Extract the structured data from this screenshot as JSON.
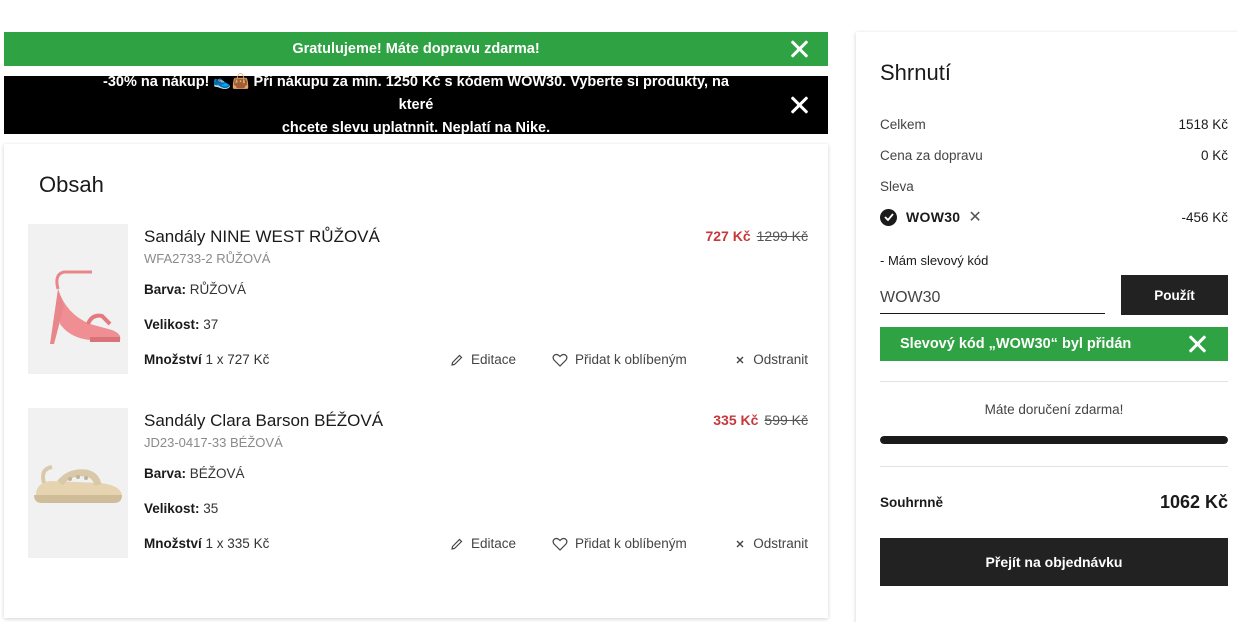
{
  "banners": {
    "shipping": "Gratulujeme! Máte dopravu zdarma!",
    "promo_line1": "-30% na nákup! 👟👜 Při nákupu za min. 1250 Kč s kódem WOW30. Vyberte si produkty, na které",
    "promo_line2": "chcete slevu uplatnnit. Neplatí na Nike."
  },
  "cart": {
    "title": "Obsah",
    "labels": {
      "color": "Barva:",
      "size": "Velikost:",
      "qty": "Množství",
      "edit": "Editace",
      "favorite": "Přidat k oblíbeným",
      "remove": "Odstranit"
    },
    "items": [
      {
        "name": "Sandály NINE WEST RŮŽOVÁ",
        "sku": "WFA2733-2 RŮŽOVÁ",
        "color": "RŮŽOVÁ",
        "size": "37",
        "qty": "1 x 727 Kč",
        "price": "727 Kč",
        "old_price": "1299 Kč"
      },
      {
        "name": "Sandály Clara Barson BÉŽOVÁ",
        "sku": "JD23-0417-33 BÉŽOVÁ",
        "color": "BÉŽOVÁ",
        "size": "35",
        "qty": "1 x 335 Kč",
        "price": "335 Kč",
        "old_price": "599 Kč"
      }
    ]
  },
  "summary": {
    "title": "Shrnutí",
    "total_label": "Celkem",
    "total_value": "1518 Kč",
    "shipping_label": "Cena za dopravu",
    "shipping_value": "0 Kč",
    "discount_label": "Sleva",
    "coupon_code": "WOW30",
    "coupon_remove": "✕",
    "coupon_value": "-456 Kč",
    "have_code_label": "- Mám slevový kód",
    "code_input_value": "WOW30",
    "apply_label": "Použít",
    "coupon_added_msg": "Slevový kód „WOW30“ byl přidán",
    "free_shipping_msg": "Máte doručení zdarma!",
    "free_shipping_progress": 1.0,
    "grand_label": "Souhrnně",
    "grand_value": "1062 Kč",
    "checkout_label": "Přejít na objednávku"
  },
  "colors": {
    "success_green": "#2fa243",
    "sale_red": "#c8373a",
    "dark": "#222222"
  }
}
